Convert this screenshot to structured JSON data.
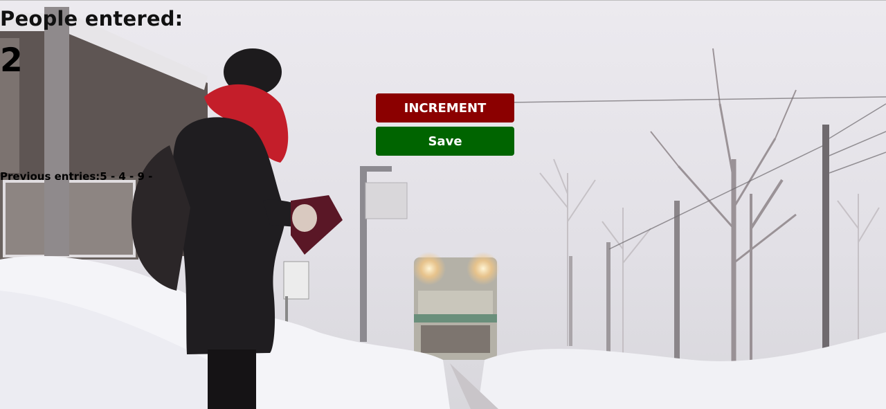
{
  "counter": {
    "heading": "People entered:",
    "count": "2"
  },
  "buttons": {
    "increment_label": "INCREMENT",
    "save_label": "Save"
  },
  "previous": {
    "label": "Previous entries:",
    "entries_text": "5 - 4 - 9 -"
  },
  "colors": {
    "increment_button": "#8b0000",
    "save_button": "#006400",
    "text": "#000000"
  }
}
